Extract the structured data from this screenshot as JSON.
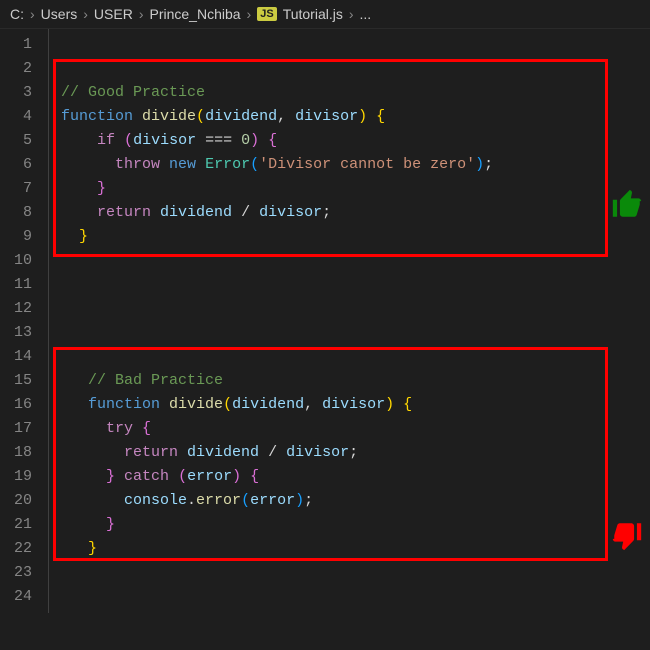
{
  "breadcrumb": {
    "drive": "C:",
    "seg1": "Users",
    "seg2": "USER",
    "seg3": "Prince_Nchiba",
    "file_icon": "JS",
    "file": "Tutorial.js",
    "more": "..."
  },
  "code": {
    "line_count": 24,
    "good": {
      "comment": "// Good Practice",
      "fn_kw": "function",
      "fn_name": "divide",
      "param1": "dividend",
      "param2": "divisor",
      "if_kw": "if",
      "cond_left": "divisor",
      "cond_op": "===",
      "cond_right": "0",
      "throw_kw": "throw",
      "new_kw": "new",
      "error_class": "Error",
      "error_msg": "'Divisor cannot be zero'",
      "return_kw": "return",
      "ret_left": "dividend",
      "ret_op": "/",
      "ret_right": "divisor"
    },
    "bad": {
      "comment": "// Bad Practice",
      "fn_kw": "function",
      "fn_name": "divide",
      "param1": "dividend",
      "param2": "divisor",
      "try_kw": "try",
      "return_kw": "return",
      "ret_left": "dividend",
      "ret_op": "/",
      "ret_right": "divisor",
      "catch_kw": "catch",
      "catch_param": "error",
      "console_obj": "console",
      "console_method": "error",
      "console_arg": "error"
    }
  },
  "icons": {
    "thumb_up_color": "#0a8a0a",
    "thumb_down_color": "#ff0000",
    "box_color": "#ff0000"
  }
}
